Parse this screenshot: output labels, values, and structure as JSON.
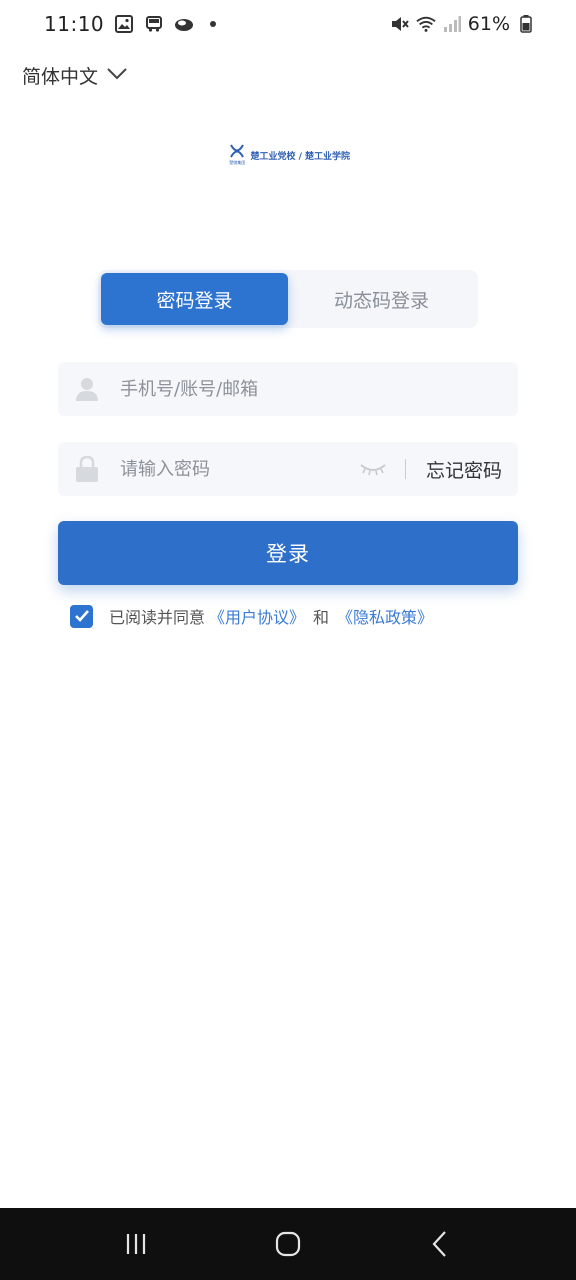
{
  "status_bar": {
    "time": "11:10",
    "battery": "61%",
    "icons_left": [
      "image-icon",
      "bus-icon",
      "cloud-icon",
      "dot-icon"
    ],
    "icons_right": [
      "mute-icon",
      "wifi-icon",
      "signal-icon",
      "battery-icon"
    ]
  },
  "language": {
    "label": "简体中文"
  },
  "logo": {
    "text": "楚工业党校 / 楚工业学院",
    "subtext": "楚储集团"
  },
  "tabs": [
    {
      "label": "密码登录",
      "active": true
    },
    {
      "label": "动态码登录",
      "active": false
    }
  ],
  "form": {
    "account_placeholder": "手机号/账号/邮箱",
    "password_placeholder": "请输入密码",
    "forgot_label": "忘记密码",
    "login_label": "登录"
  },
  "agreement": {
    "checked": true,
    "prefix": "已阅读并同意",
    "user_agreement": "《用户协议》",
    "and": "和",
    "privacy_policy": "《隐私政策》"
  },
  "colors": {
    "primary": "#2d73d0",
    "link": "#3a7bd5",
    "field_bg": "#f5f7fa",
    "nav_bg": "#0f0f0f"
  },
  "nav": {
    "buttons": [
      "recent-apps",
      "home",
      "back"
    ]
  }
}
